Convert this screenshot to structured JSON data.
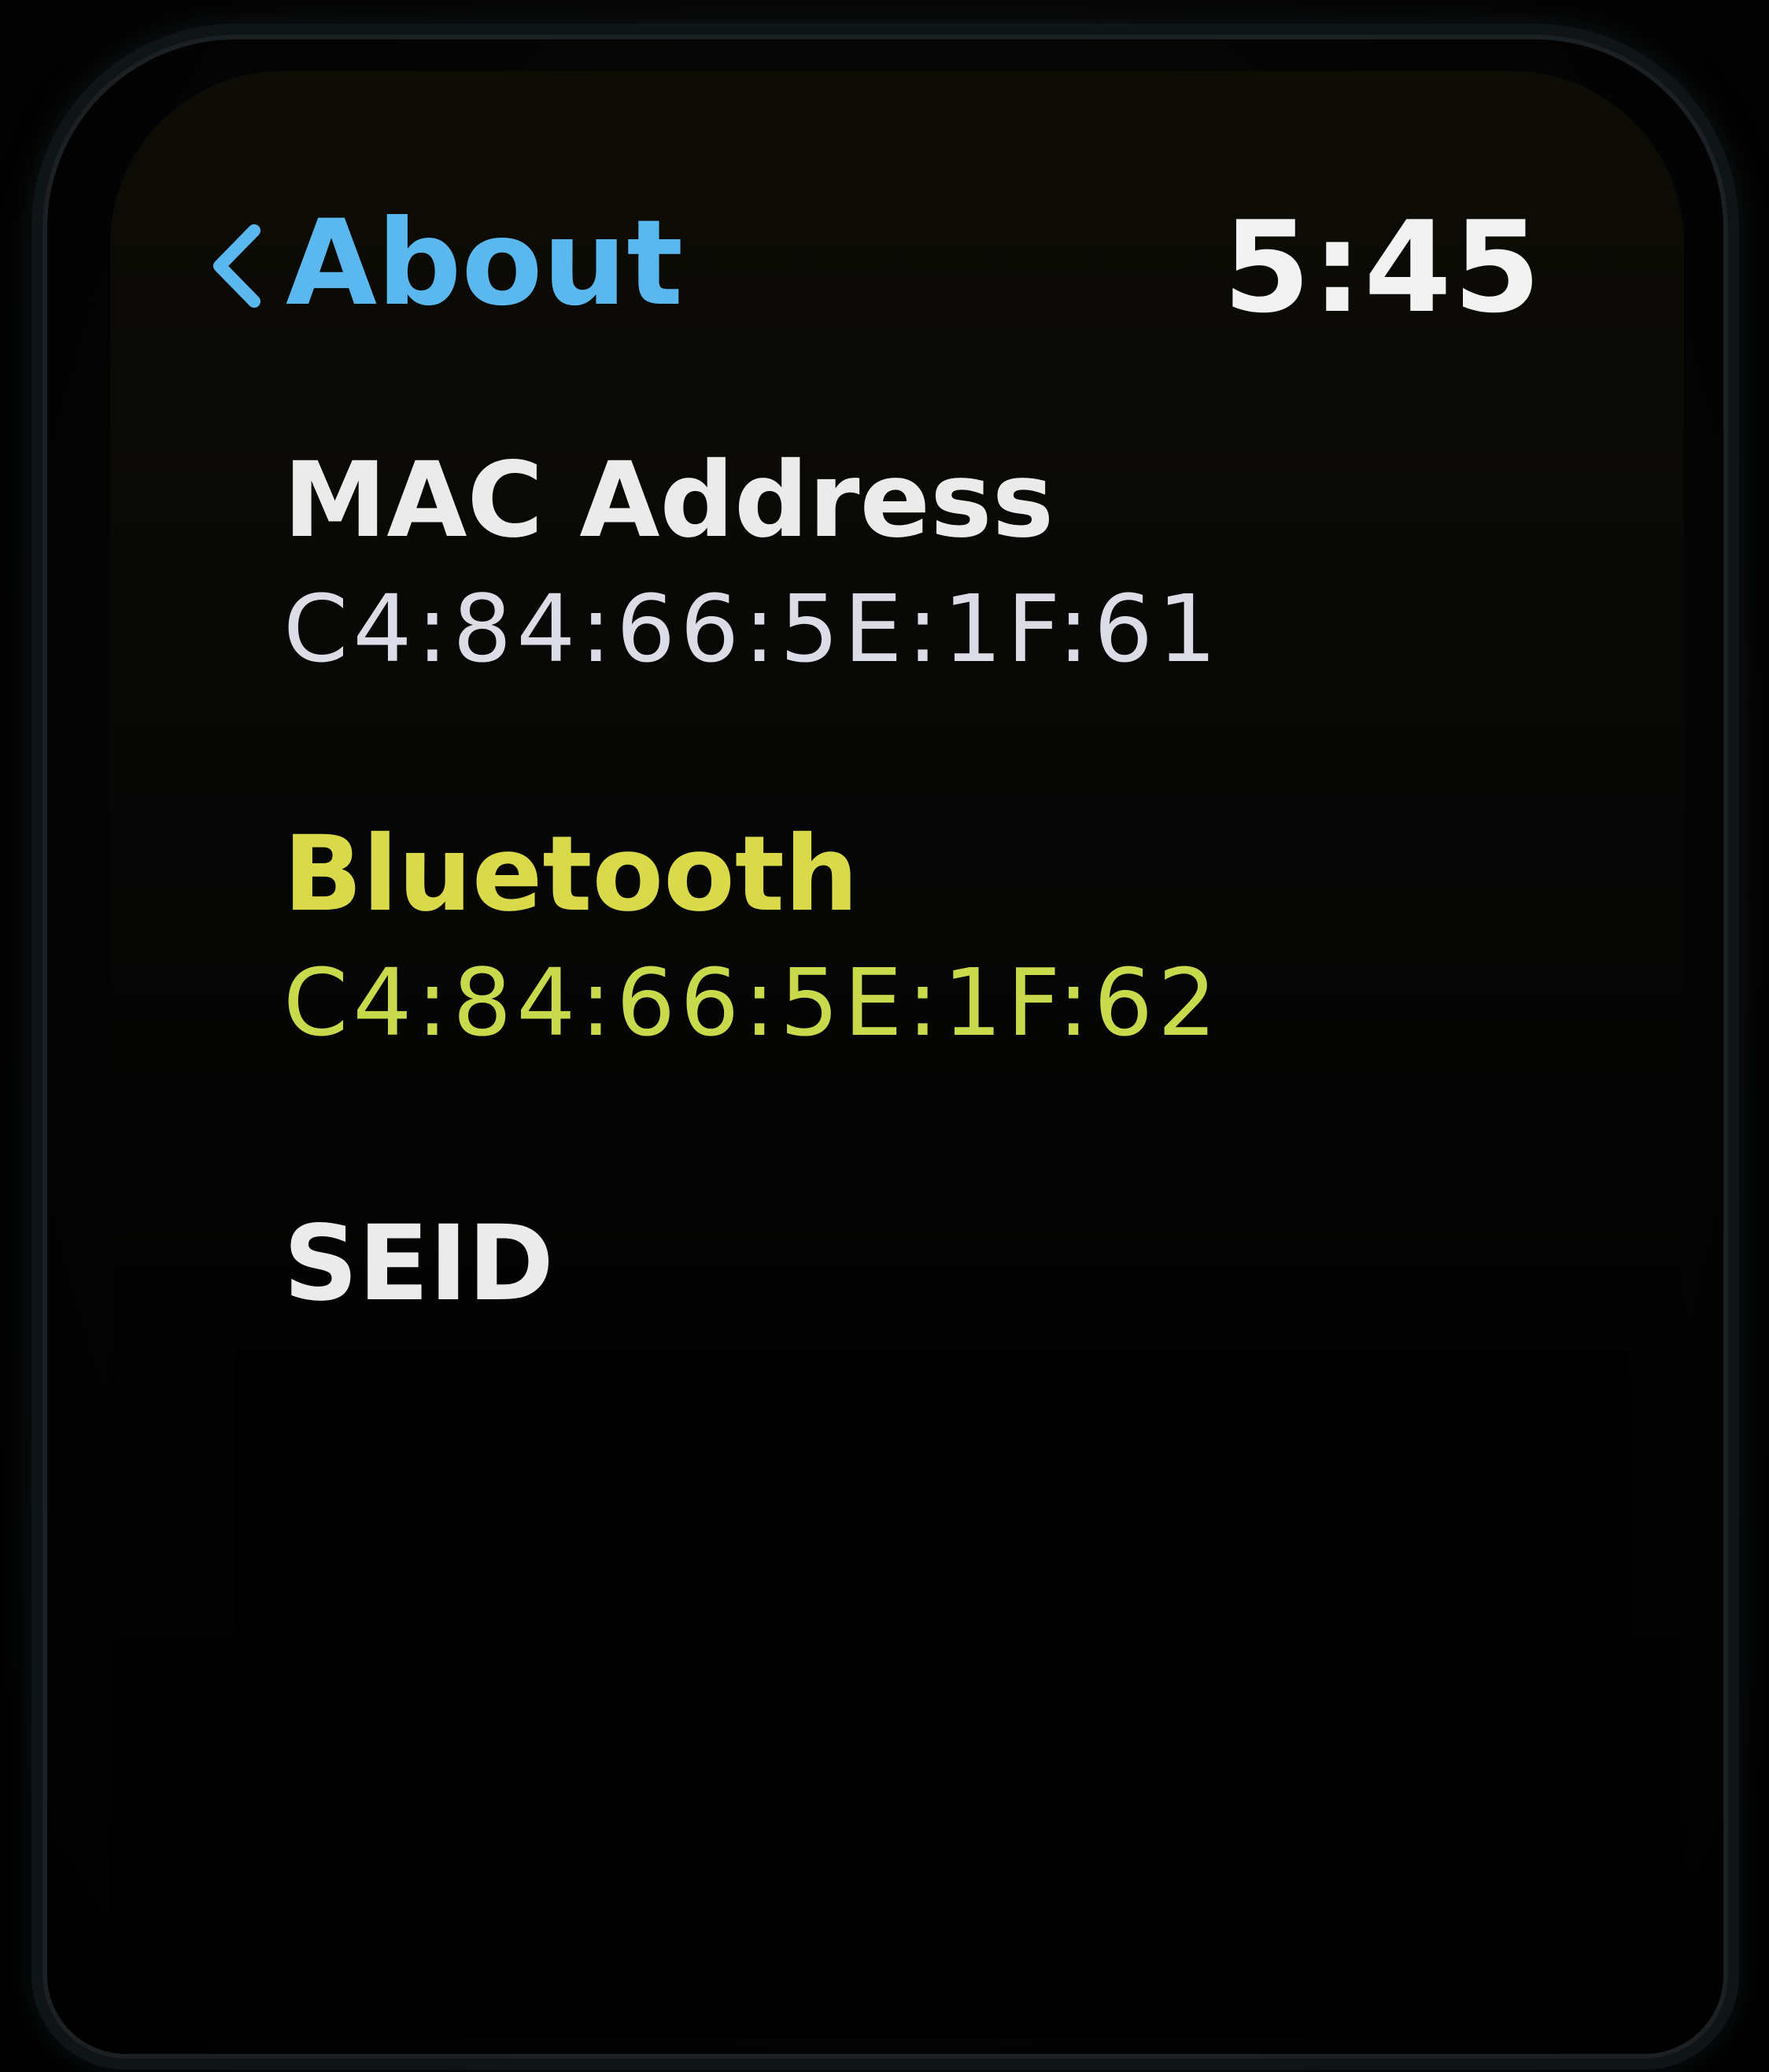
{
  "header": {
    "back_label": "About",
    "back_icon": "chevron-left-icon",
    "time": "5:45"
  },
  "items": [
    {
      "label": "MAC Address",
      "value": "C4:84:66:5E:1F:61"
    },
    {
      "label": "Bluetooth",
      "value": "C4:84:66:5E:1F:62"
    },
    {
      "label": "SEID",
      "value": ""
    }
  ],
  "colors": {
    "background": "#000000",
    "accent_blue": "#5ab8ef",
    "text_white": "#ecebeb",
    "highlight_yellow": "#d9d94a"
  }
}
